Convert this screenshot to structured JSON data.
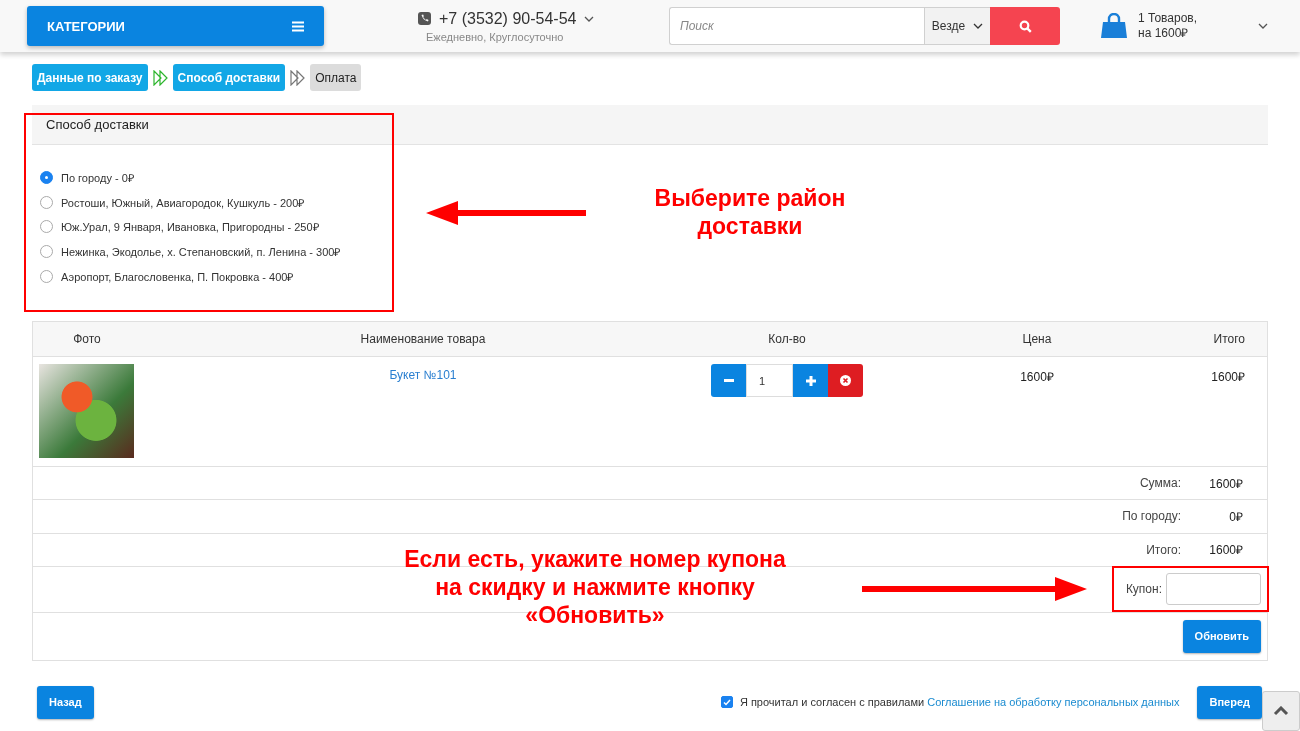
{
  "header": {
    "categories_label": "КАТЕГОРИИ",
    "phone": "+7 (3532) 90-54-54",
    "hours": "Ежедневно, Круглосуточно",
    "search": {
      "placeholder": "Поиск",
      "scope": "Везде"
    },
    "cart": {
      "line_1": "1 Товаров,",
      "line_2": "на 1600₽"
    }
  },
  "steps": [
    {
      "label": "Данные по заказу",
      "active": true
    },
    {
      "label": "Способ доставки",
      "active": true
    },
    {
      "label": "Оплата",
      "active": false
    }
  ],
  "delivery": {
    "title": "Способ доставки",
    "options": [
      {
        "label": "По городу - 0₽",
        "selected": true
      },
      {
        "label": "Ростоши, Южный, Авиагородок, Кушкуль - 200₽",
        "selected": false
      },
      {
        "label": "Юж.Урал, 9 Января, Ивановка, Пригородны - 250₽",
        "selected": false
      },
      {
        "label": "Нежинка, Экодолье, х. Степановский, п. Ленина - 300₽",
        "selected": false
      },
      {
        "label": "Аэропорт, Благословенка, П. Покровка - 400₽",
        "selected": false
      }
    ]
  },
  "cart_table": {
    "columns": [
      "Фото",
      "Наименование товара",
      "Кол-во",
      "Цена",
      "Итого"
    ],
    "rows": [
      {
        "name": "Букет №101",
        "quantity": "1",
        "price": "1600₽",
        "total": "1600₽"
      }
    ],
    "summary": [
      {
        "label": "Сумма:",
        "value": "1600₽"
      },
      {
        "label": "По городу:",
        "value": "0₽"
      },
      {
        "label": "Итого:",
        "value": "1600₽"
      }
    ],
    "coupon": {
      "label": "Купон:"
    },
    "update_button": "Обновить"
  },
  "footer": {
    "back_button": "Назад",
    "consent": {
      "checked": true,
      "text": "Я прочитал и согласен с правилами",
      "link": "Соглашение на обработку персональных данных"
    },
    "next_button": "Вперед"
  },
  "annotations": [
    {
      "text": "Выберите район\nдоставки",
      "kind": "left-arrow"
    },
    {
      "text": "Если есть, укажите номер купона\nна скидку и нажмите кнопку\n«Обновить»",
      "kind": "right-arrow"
    }
  ]
}
